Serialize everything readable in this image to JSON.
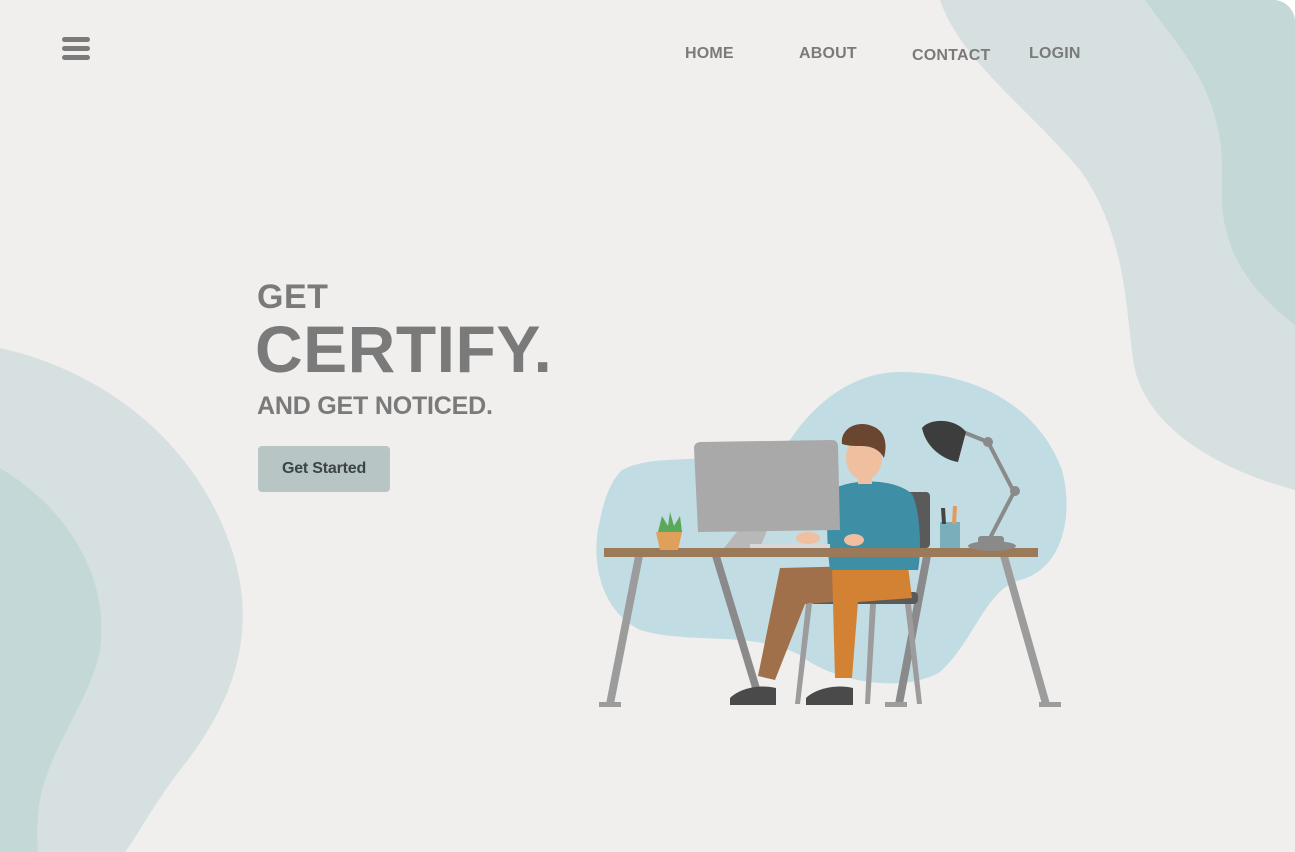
{
  "nav": {
    "menu_icon": "hamburger-menu-icon",
    "home": "HOME",
    "about": "ABOUT",
    "contact": "CONTACT",
    "login": "LOGIN"
  },
  "hero": {
    "line1": "GET",
    "line2": "CERTIFY.",
    "line3": "AND GET NOTICED.",
    "cta": "Get Started"
  },
  "illustration": {
    "subject": "person-working-at-desk-illustration"
  },
  "colors": {
    "background": "#f0efed",
    "blob_light": "#d7e0e0",
    "blob_teal": "#c4d8d7",
    "text": "#7a7a7a",
    "button": "#b8c5c5"
  }
}
